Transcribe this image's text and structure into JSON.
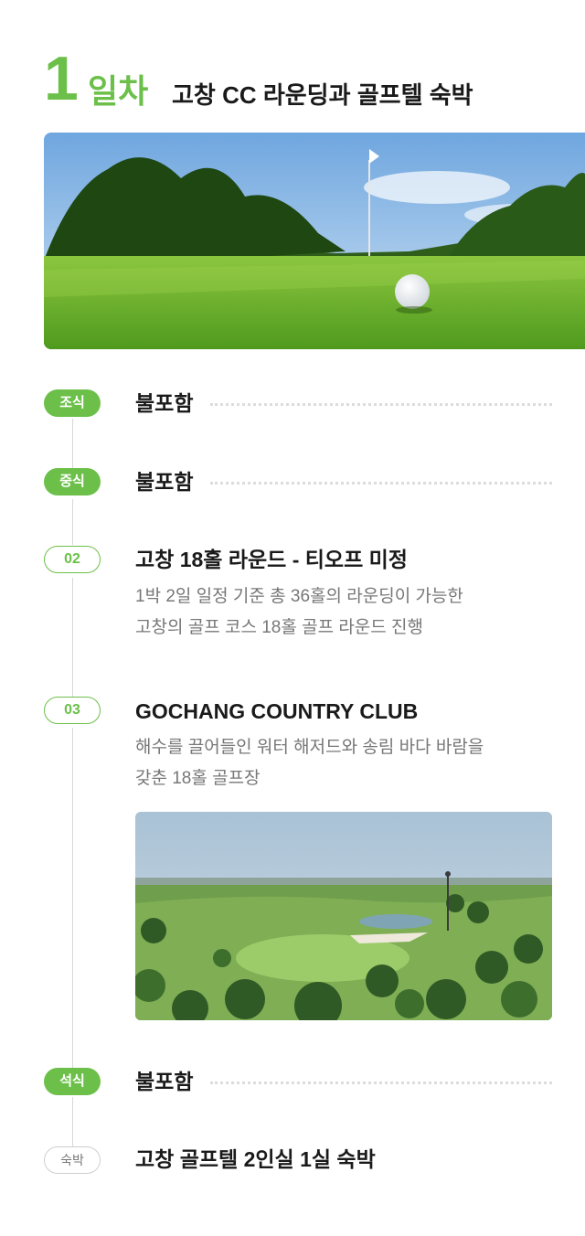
{
  "day": {
    "number": "1",
    "word": "일차",
    "title": "고창 CC 라운딩과 골프텔 숙박"
  },
  "colors": {
    "accent": "#6cc04a",
    "text": "#1a1a1a",
    "muted": "#777777",
    "line": "#d8d8d8"
  },
  "items": [
    {
      "badge": "조식",
      "title": "불포함"
    },
    {
      "badge": "중식",
      "title": "불포함"
    },
    {
      "badge": "02",
      "title": "고창 18홀 라운드 - 티오프 미정",
      "desc": [
        "1박 2일 일정 기준 총 36홀의 라운딩이 가능한",
        "고창의 골프 코스 18홀 골프 라운드 진행"
      ]
    },
    {
      "badge": "03",
      "title": "GOCHANG COUNTRY CLUB",
      "desc": [
        "해수를 끌어들인 워터 해저드와 송림 바다 바람을",
        "갖춘 18홀 골프장"
      ]
    },
    {
      "badge": "석식",
      "title": "불포함"
    },
    {
      "badge": "숙박",
      "title": "고창 골프텔 2인실 1실 숙박"
    }
  ]
}
